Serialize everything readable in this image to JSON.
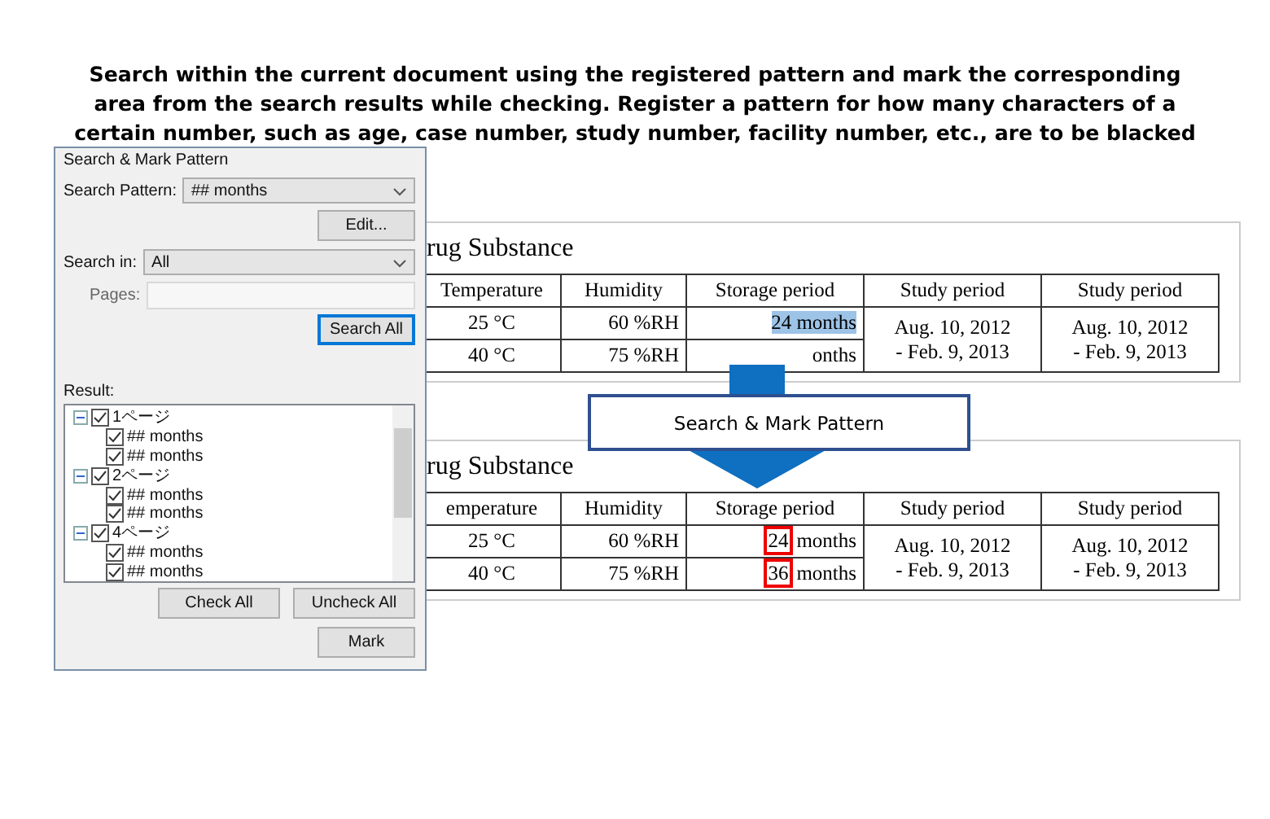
{
  "heading": [
    "Search within the current document using the registered pattern and mark the corresponding",
    "area from the search results while checking. Register a pattern for how many characters of a",
    "certain number, such as age, case number, study number, facility number, etc., are to be blacked"
  ],
  "panel": {
    "title": "Search & Mark Pattern",
    "pattern_label": "Search Pattern:",
    "pattern_value": "## months",
    "edit_button": "Edit...",
    "search_in_label": "Search in:",
    "search_in_value": "All",
    "pages_label": "Pages:",
    "search_all_button": "Search All",
    "result_label": "Result:",
    "results": [
      {
        "label": "1ページ",
        "checked": true,
        "expanded": true,
        "children": [
          {
            "label": "## months",
            "checked": true
          },
          {
            "label": "## months",
            "checked": true
          }
        ]
      },
      {
        "label": "2ページ",
        "checked": true,
        "expanded": true,
        "children": [
          {
            "label": "## months",
            "checked": true
          },
          {
            "label": "## months",
            "checked": true
          }
        ]
      },
      {
        "label": "4ページ",
        "checked": true,
        "expanded": true,
        "children": [
          {
            "label": "## months",
            "checked": true
          },
          {
            "label": "## months",
            "checked": true
          }
        ]
      }
    ],
    "check_all_button": "Check All",
    "uncheck_all_button": "Uncheck All",
    "mark_button": "Mark"
  },
  "documents": [
    {
      "title": "rug Substance",
      "columns": [
        "Temperature",
        "Humidity",
        "Storage period",
        "Study period",
        "Study period"
      ],
      "rows": [
        {
          "temperature": "25 °C",
          "humidity": "60 %RH",
          "storage": {
            "text": "24 months",
            "highlighted": true
          }
        },
        {
          "temperature": "40 °C",
          "humidity": "75 %RH",
          "storage": {
            "text": "onths",
            "highlighted": false
          }
        }
      ],
      "study": [
        [
          "Aug. 10, 2012",
          "- Feb. 9, 2013"
        ],
        [
          "Aug. 10, 2012",
          "- Feb. 9, 2013"
        ]
      ]
    },
    {
      "title": "rug Substance",
      "columns": [
        "emperature",
        "Humidity",
        "Storage period",
        "Study period",
        "Study period"
      ],
      "rows": [
        {
          "temperature": "25 °C",
          "humidity": "60 %RH",
          "storage": {
            "mark": "24",
            "text": "months",
            "highlighted": false
          }
        },
        {
          "temperature": "40 °C",
          "humidity": "75 %RH",
          "storage": {
            "mark": "36",
            "text": "months",
            "highlighted": false
          }
        }
      ],
      "study": [
        [
          "Aug. 10, 2012",
          "- Feb. 9, 2013"
        ],
        [
          "Aug. 10, 2012",
          "- Feb. 9, 2013"
        ]
      ]
    }
  ],
  "callout": "Search & Mark Pattern"
}
